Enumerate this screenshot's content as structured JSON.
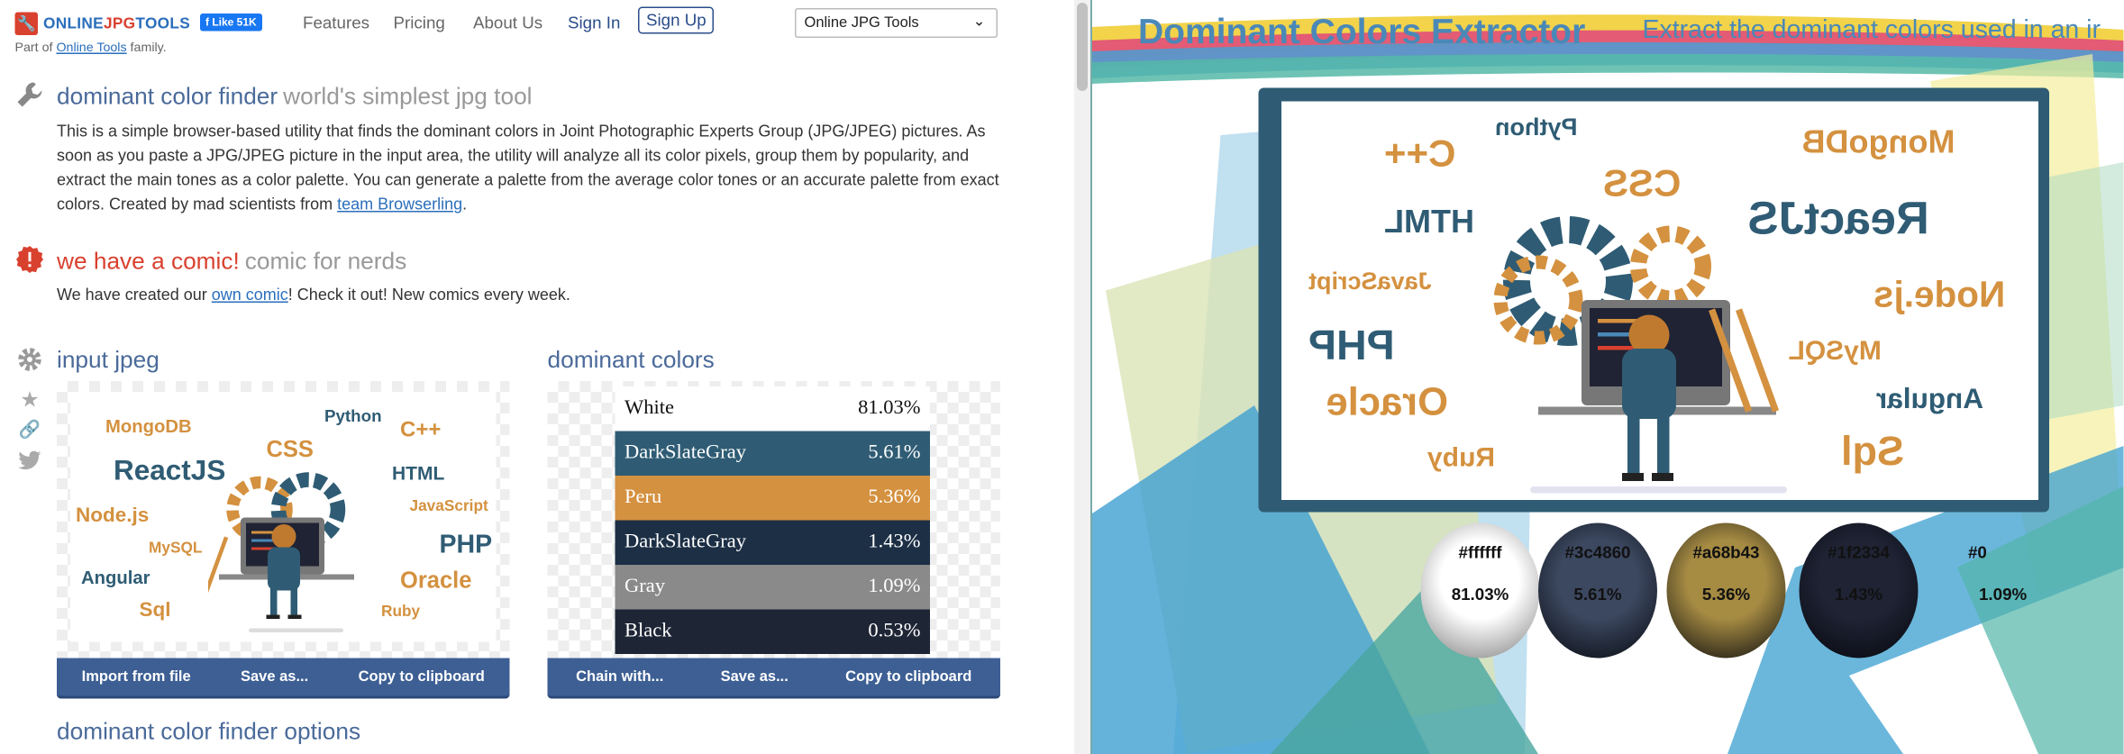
{
  "header": {
    "logo_online": "ONLINE",
    "logo_jpg": "JPG",
    "logo_tools": "TOOLS",
    "tagline_prefix": "Part of ",
    "tagline_link": "Online Tools",
    "tagline_suffix": " family.",
    "fb_like": "Like 51K",
    "nav_features": "Features",
    "nav_pricing": "Pricing",
    "nav_about": "About Us",
    "nav_signin": "Sign In",
    "nav_signup": "Sign Up",
    "tool_select": "Online JPG Tools"
  },
  "intro": {
    "title": "dominant color finder",
    "subtitle": "world's simplest jpg tool",
    "text": "This is a simple browser-based utility that finds the dominant colors in Joint Photographic Experts Group (JPG/JPEG) pictures. As soon as you paste a JPG/JPEG picture in the input area, the utility will analyze all its color pixels, group them by popularity, and extract the main tones as a color palette. You can generate a palette from the average color tones or an accurate palette from exact colors. Created by mad scientists from ",
    "link": "team Browserling",
    "text_end": "."
  },
  "comic": {
    "title": "we have a comic!",
    "subtitle": "comic for nerds",
    "text_prefix": "We have created our ",
    "link": "own comic",
    "text_suffix": "! Check it out! New comics every week."
  },
  "input_panel": {
    "title": "input jpeg",
    "buttons": [
      "Import from file",
      "Save as...",
      "Copy to clipboard"
    ],
    "thumb_words": [
      "Python",
      "MongoDB",
      "CSS",
      "C++",
      "ReactJS",
      "HTML",
      "Node.js",
      "JavaScript",
      "MySQL",
      "PHP",
      "Angular",
      "Oracle",
      "Sql",
      "Ruby"
    ]
  },
  "output_panel": {
    "title": "dominant colors",
    "buttons": [
      "Chain with...",
      "Save as...",
      "Copy to clipboard"
    ],
    "colors": [
      {
        "name": "White",
        "pct": "81.03%",
        "bg": "#ffffff",
        "fg": "#111111"
      },
      {
        "name": "DarkSlateGray",
        "pct": "5.61%",
        "bg": "#2f5c74",
        "fg": "#ffffff"
      },
      {
        "name": "Peru",
        "pct": "5.36%",
        "bg": "#d4913f",
        "fg": "#ffffff"
      },
      {
        "name": "DarkSlateGray",
        "pct": "1.43%",
        "bg": "#1c2f45",
        "fg": "#ffffff"
      },
      {
        "name": "Gray",
        "pct": "1.09%",
        "bg": "#8a8a8a",
        "fg": "#ffffff"
      },
      {
        "name": "Black",
        "pct": "0.53%",
        "bg": "#1e2535",
        "fg": "#ffffff"
      }
    ]
  },
  "options": {
    "title": "dominant color finder options"
  },
  "video": {
    "title": "Dominant Colors Extractor",
    "subtitle": "Extract the dominant colors used in an ir",
    "words": [
      "Python",
      "C++",
      "CSS",
      "MongoDB",
      "HTML",
      "ReactJS",
      "JavaScript",
      "Node.js",
      "PHP",
      "MySQL",
      "Oracle",
      "Angular",
      "Ruby",
      "Sql"
    ],
    "swatches": [
      {
        "hex": "#ffffff",
        "pct": "81.03%",
        "color": "#ffffff"
      },
      {
        "hex": "#3c4860",
        "pct": "5.61%",
        "color": "#3c4860"
      },
      {
        "hex": "#a68b43",
        "pct": "5.36%",
        "color": "#a68b43"
      },
      {
        "hex": "#1f2334",
        "pct": "1.43%",
        "color": "#1f2334"
      },
      {
        "hex": "#0",
        "pct": "1.09%",
        "color": "#000000"
      }
    ]
  },
  "colors": {
    "brand_red": "#d9412f",
    "brand_blue": "#2a6ebb",
    "toolbar": "#3d5f94",
    "title_blue": "#4a6a9a",
    "orange_word": "#d4913f",
    "teal_word": "#2f5c74"
  }
}
